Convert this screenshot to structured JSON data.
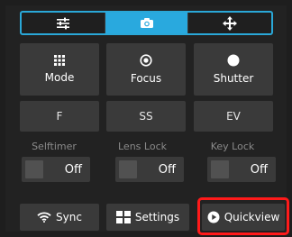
{
  "tabs": [
    {
      "icon": "sliders-icon",
      "active": false
    },
    {
      "icon": "camera-icon",
      "active": true
    },
    {
      "icon": "move-arrows-icon",
      "active": false
    }
  ],
  "controls": {
    "mode_label": "Mode",
    "focus_label": "Focus",
    "shutter_label": "Shutter"
  },
  "exposure": {
    "f_label": "F",
    "ss_label": "SS",
    "ev_label": "EV"
  },
  "toggles": [
    {
      "caption": "Selftimer",
      "value": "Off"
    },
    {
      "caption": "Lens Lock",
      "value": "Off"
    },
    {
      "caption": "Key Lock",
      "value": "Off"
    }
  ],
  "bottom": {
    "sync_label": "Sync",
    "settings_label": "Settings",
    "quickview_label": "Quickview"
  },
  "colors": {
    "accent": "#29a9de",
    "highlight": "#ff1a1a",
    "button": "#3a3a3a"
  }
}
